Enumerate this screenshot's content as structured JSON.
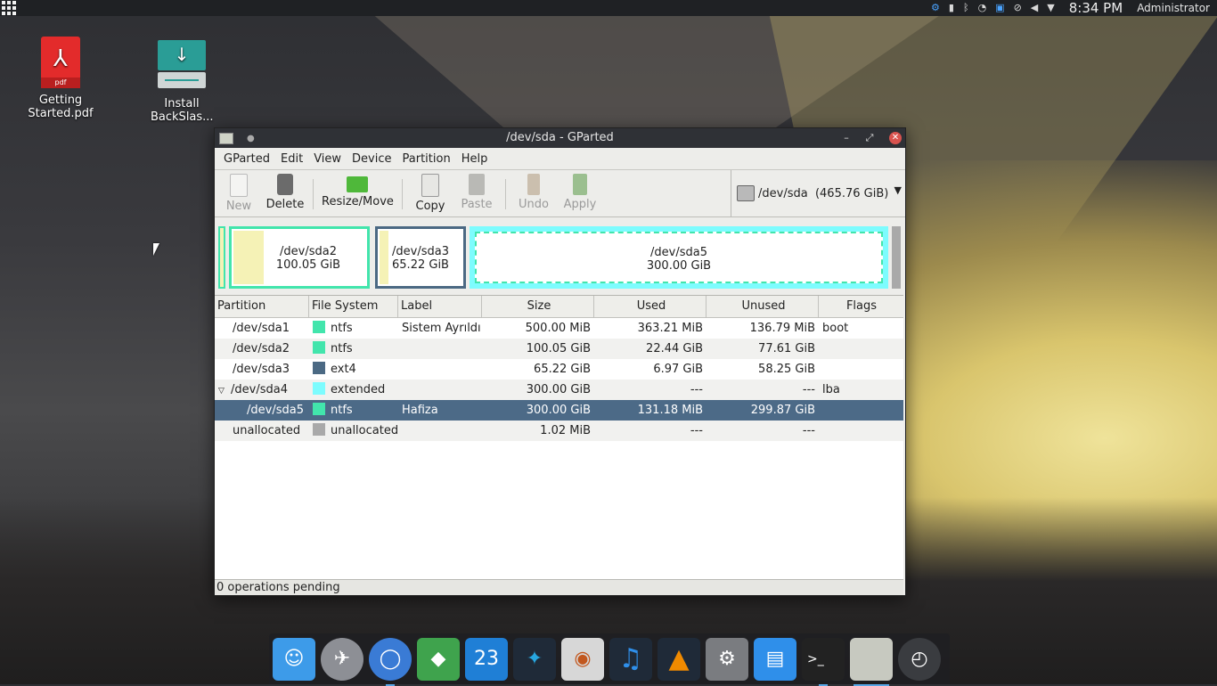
{
  "top_panel": {
    "clock": "8:34 PM",
    "user": "Administrator",
    "tray_icons": [
      "settings-icon",
      "battery-icon",
      "bluetooth-icon",
      "wifi-icon",
      "clipboard-icon",
      "attachment-icon",
      "volume-icon",
      "dropdown-icon"
    ]
  },
  "desktop": {
    "icons": [
      {
        "label": "Getting Started.pdf",
        "badge": "pdf"
      },
      {
        "label": "Install BackSlas..."
      }
    ]
  },
  "window": {
    "title": "/dev/sda - GParted",
    "menu": [
      "GParted",
      "Edit",
      "View",
      "Device",
      "Partition",
      "Help"
    ],
    "toolbar": {
      "new": "New",
      "delete": "Delete",
      "resize": "Resize/Move",
      "copy": "Copy",
      "paste": "Paste",
      "undo": "Undo",
      "apply": "Apply"
    },
    "device": "/dev/sda  (465.76 GiB)",
    "map": {
      "sda2": {
        "name": "/dev/sda2",
        "size": "100.05 GiB"
      },
      "sda3": {
        "name": "/dev/sda3",
        "size": "65.22 GiB"
      },
      "sda5": {
        "name": "/dev/sda5",
        "size": "300.00 GiB"
      }
    },
    "columns": [
      "Partition",
      "File System",
      "Label",
      "Size",
      "Used",
      "Unused",
      "Flags"
    ],
    "rows": [
      {
        "partition": "/dev/sda1",
        "fs": "ntfs",
        "label": "Sistem Ayrıldı",
        "size": "500.00 MiB",
        "used": "363.21 MiB",
        "unused": "136.79 MiB",
        "flags": "boot"
      },
      {
        "partition": "/dev/sda2",
        "fs": "ntfs",
        "label": "",
        "size": "100.05 GiB",
        "used": "22.44 GiB",
        "unused": "77.61 GiB",
        "flags": ""
      },
      {
        "partition": "/dev/sda3",
        "fs": "ext4",
        "label": "",
        "size": "65.22 GiB",
        "used": "6.97 GiB",
        "unused": "58.25 GiB",
        "flags": ""
      },
      {
        "partition": "/dev/sda4",
        "fs": "extended",
        "label": "",
        "size": "300.00 GiB",
        "used": "---",
        "unused": "---",
        "flags": "lba"
      },
      {
        "partition": "/dev/sda5",
        "fs": "ntfs",
        "label": "Hafiza",
        "size": "300.00 GiB",
        "used": "131.18 MiB",
        "unused": "299.87 GiB",
        "flags": ""
      },
      {
        "partition": "unallocated",
        "fs": "unallocated",
        "label": "",
        "size": "1.02 MiB",
        "used": "---",
        "unused": "---",
        "flags": ""
      }
    ],
    "colors": {
      "ntfs": "#42e5ac",
      "ext4": "#4b6983",
      "extended": "#7dfcfe",
      "unallocated": "#a9a9a9",
      "selected": "#4c6a87"
    },
    "status": "0 operations pending"
  },
  "dock": {
    "calendar_day": "23",
    "apps": [
      "finder-icon",
      "launchpad-icon",
      "chromium-icon",
      "maps-icon",
      "calendar-icon",
      "kodi-icon",
      "camera-icon",
      "music-icon",
      "vlc-icon",
      "system-settings-icon",
      "app-store-icon",
      "terminal-icon",
      "gparted-icon",
      "clock-icon"
    ]
  }
}
